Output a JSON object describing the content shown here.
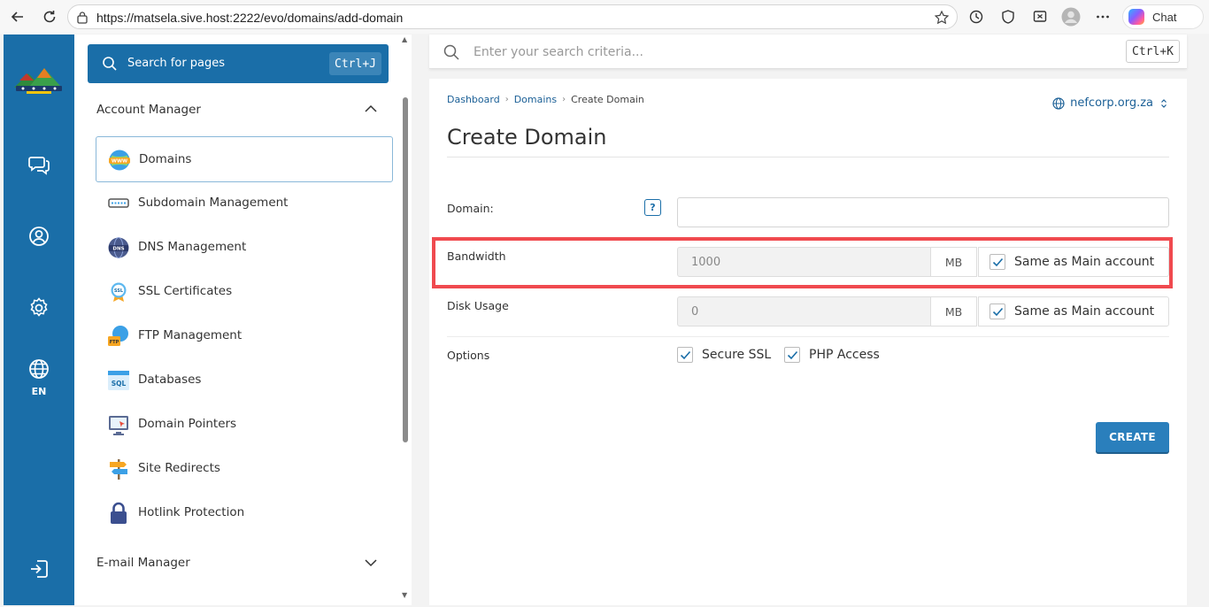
{
  "browser": {
    "url": "https://matsela.sive.host:2222/evo/domains/add-domain",
    "chat_label": "Chat"
  },
  "rail": {
    "language": "EN"
  },
  "sidebar": {
    "search_label": "Search for pages",
    "search_shortcut": "Ctrl+J",
    "account_manager": {
      "title": "Account Manager",
      "items": [
        {
          "label": "Domains",
          "icon": "www-globe-icon",
          "active": true
        },
        {
          "label": "Subdomain Management",
          "icon": "subdomain-icon"
        },
        {
          "label": "DNS Management",
          "icon": "dns-icon"
        },
        {
          "label": "SSL Certificates",
          "icon": "ssl-certificate-icon"
        },
        {
          "label": "FTP Management",
          "icon": "ftp-icon"
        },
        {
          "label": "Databases",
          "icon": "sql-database-icon"
        },
        {
          "label": "Domain Pointers",
          "icon": "domain-pointer-icon"
        },
        {
          "label": "Site Redirects",
          "icon": "signpost-icon"
        },
        {
          "label": "Hotlink Protection",
          "icon": "padlock-icon"
        }
      ]
    },
    "email_manager": {
      "title": "E-mail Manager"
    }
  },
  "top_search": {
    "placeholder": "Enter your search criteria...",
    "shortcut": "Ctrl+K"
  },
  "main": {
    "breadcrumb": [
      "Dashboard",
      "Domains",
      "Create Domain"
    ],
    "selected_domain": "nefcorp.org.za",
    "title": "Create Domain",
    "form": {
      "domain_label": "Domain:",
      "help": "?",
      "domain_value": "",
      "bandwidth_label": "Bandwidth",
      "bandwidth_value": "1000",
      "bandwidth_unit": "MB",
      "bandwidth_same_label": "Same as Main account",
      "bandwidth_same_checked": true,
      "disk_label": "Disk Usage",
      "disk_value": "0",
      "disk_unit": "MB",
      "disk_same_label": "Same as Main account",
      "disk_same_checked": true,
      "options_label": "Options",
      "secure_ssl_label": "Secure SSL",
      "secure_ssl_checked": true,
      "php_access_label": "PHP Access",
      "php_access_checked": true
    },
    "create_label": "CREATE"
  },
  "colors": {
    "brand_blue": "#1a6ea8",
    "highlight_red": "#f04a4f",
    "check_blue": "#1a6ea8"
  }
}
